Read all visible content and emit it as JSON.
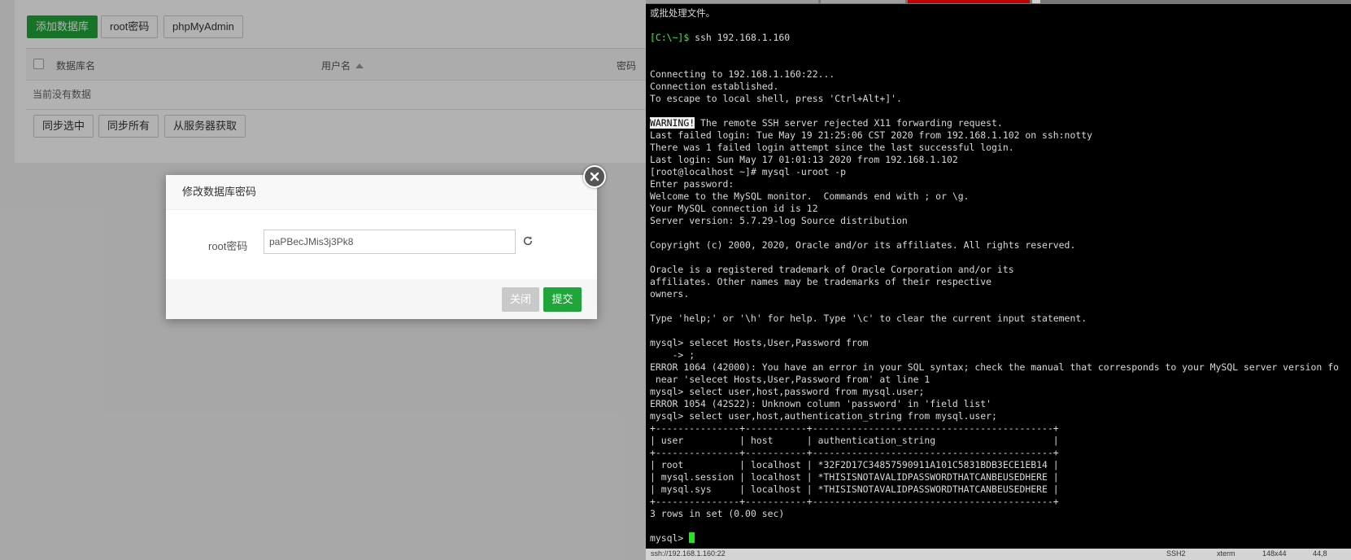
{
  "toolbar": {
    "add_db": "添加数据库",
    "root_pw": "root密码",
    "phpmyadmin": "phpMyAdmin"
  },
  "table": {
    "columns": [
      "数据库名",
      "用户名",
      "密码"
    ],
    "empty_text": "当前没有数据"
  },
  "bottom_buttons": [
    "同步选中",
    "同步所有",
    "从服务器获取"
  ],
  "modal": {
    "title": "修改数据库密码",
    "field_label": "root密码",
    "password_value": "paPBecJMis3j3Pk8",
    "close_label": "关闭",
    "submit_label": "提交"
  },
  "terminal": {
    "lines": [
      "或批处理文件。",
      "",
      "[C:\\~]$ ssh 192.168.1.160",
      "",
      "",
      "Connecting to 192.168.1.160:22...",
      "Connection established.",
      "To escape to local shell, press 'Ctrl+Alt+]'.",
      "",
      "WARNING! The remote SSH server rejected X11 forwarding request.",
      "Last failed login: Tue May 19 21:25:06 CST 2020 from 192.168.1.102 on ssh:notty",
      "There was 1 failed login attempt since the last successful login.",
      "Last login: Sun May 17 01:01:13 2020 from 192.168.1.102",
      "[root@localhost ~]# mysql -uroot -p",
      "Enter password:",
      "Welcome to the MySQL monitor.  Commands end with ; or \\g.",
      "Your MySQL connection id is 12",
      "Server version: 5.7.29-log Source distribution",
      "",
      "Copyright (c) 2000, 2020, Oracle and/or its affiliates. All rights reserved.",
      "",
      "Oracle is a registered trademark of Oracle Corporation and/or its",
      "affiliates. Other names may be trademarks of their respective",
      "owners.",
      "",
      "Type 'help;' or '\\h' for help. Type '\\c' to clear the current input statement.",
      "",
      "mysql> selecet Hosts,User,Password from",
      "    -> ;",
      "ERROR 1064 (42000): You have an error in your SQL syntax; check the manual that corresponds to your MySQL server version fo",
      " near 'selecet Hosts,User,Password from' at line 1",
      "mysql> select user,host,password from mysql.user;",
      "ERROR 1054 (42S22): Unknown column 'password' in 'field list'",
      "mysql> select user,host,authentication_string from mysql.user;",
      "+---------------+-----------+-------------------------------------------+",
      "| user          | host      | authentication_string                     |",
      "+---------------+-----------+-------------------------------------------+",
      "| root          | localhost | *32F2D17C34857590911A101C5831BDB3ECE1EB14 |",
      "| mysql.session | localhost | *THISISNOTAVALIDPASSWORDTHATCANBEUSEDHERE |",
      "| mysql.sys     | localhost | *THISISNOTAVALIDPASSWORDTHATCANBEUSEDHERE |",
      "+---------------+-----------+-------------------------------------------+",
      "3 rows in set (0.00 sec)",
      "",
      "mysql> "
    ],
    "status": {
      "path": "ssh://192.168.1.160:22",
      "ssh": "SSH2",
      "term": "xterm",
      "size": "148x44",
      "pos": "44,8"
    }
  },
  "colors": {
    "green": "#20a53a",
    "prompt": "#2bff2b",
    "terminal_bg": "#000000"
  }
}
